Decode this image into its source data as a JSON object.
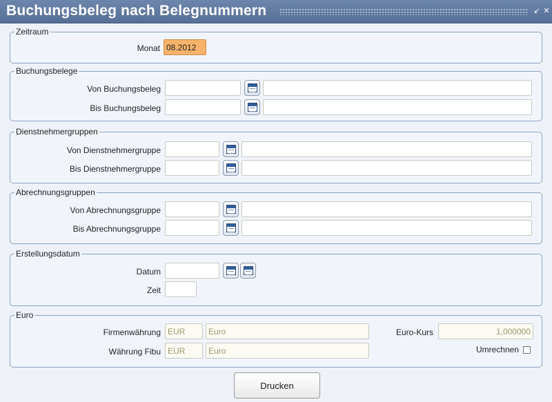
{
  "window": {
    "title": "Buchungsbeleg nach Belegnummern",
    "minimize_icon": "minimize-icon",
    "close_icon": "close-icon"
  },
  "zeitraum": {
    "legend": "Zeitraum",
    "monat_label": "Monat",
    "monat_value": "08.2012"
  },
  "buchungsbelege": {
    "legend": "Buchungsbelege",
    "von_label": "Von Buchungsbeleg",
    "bis_label": "Bis Buchungsbeleg",
    "von_value": "",
    "von_desc": "",
    "bis_value": "",
    "bis_desc": ""
  },
  "dienstnehmergruppen": {
    "legend": "Dienstnehmergruppen",
    "von_label": "Von Dienstnehmergruppe",
    "bis_label": "Bis Dienstnehmergruppe",
    "von_value": "",
    "von_desc": "",
    "bis_value": "",
    "bis_desc": ""
  },
  "abrechnungsgruppen": {
    "legend": "Abrechnungsgruppen",
    "von_label": "Von Abrechnungsgruppe",
    "bis_label": "Bis Abrechnungsgruppe",
    "von_value": "",
    "von_desc": "",
    "bis_value": "",
    "bis_desc": ""
  },
  "erstellungsdatum": {
    "legend": "Erstellungsdatum",
    "datum_label": "Datum",
    "zeit_label": "Zeit",
    "datum_value": "",
    "zeit_value": ""
  },
  "euro": {
    "legend": "Euro",
    "firmenwaehrung_label": "Firmenwährung",
    "firmenwaehrung_code": "EUR",
    "firmenwaehrung_name": "Euro",
    "waehrung_fibu_label": "Währung Fibu",
    "waehrung_fibu_code": "EUR",
    "waehrung_fibu_name": "Euro",
    "eurokurs_label": "Euro-Kurs",
    "eurokurs_value": "1,000000",
    "umrechnen_label": "Umrechnen",
    "umrechnen_checked": false
  },
  "actions": {
    "drucken_label": "Drucken"
  },
  "icons": {
    "lookup": "lookup-icon",
    "calendar": "calendar-icon"
  }
}
